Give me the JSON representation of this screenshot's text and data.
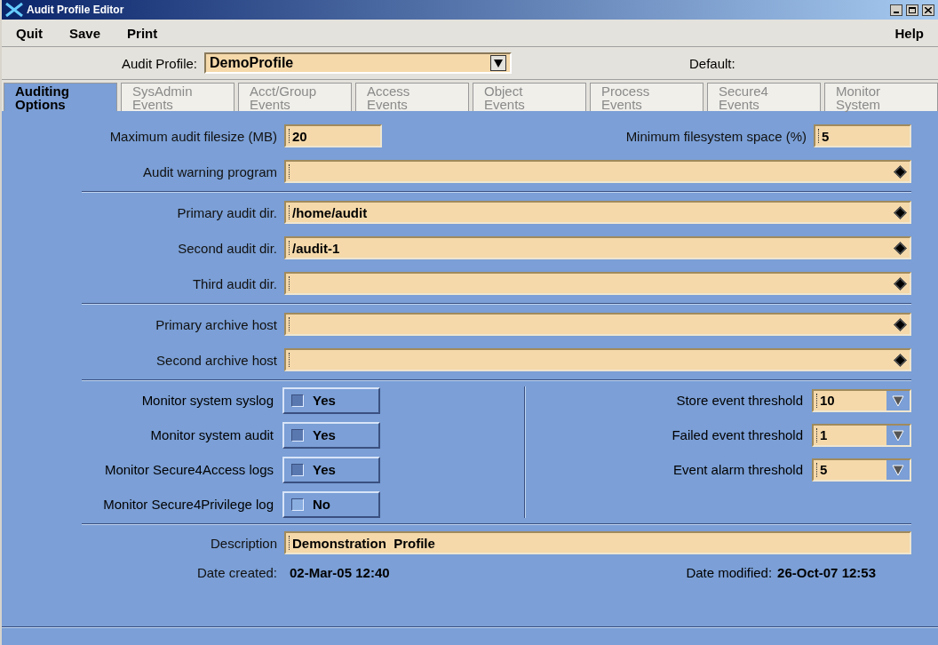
{
  "window": {
    "title": "Audit Profile Editor"
  },
  "menu": [
    {
      "label": "Quit"
    },
    {
      "label": "Save"
    },
    {
      "label": "Print"
    }
  ],
  "help_menu": {
    "label": "Help"
  },
  "profile": {
    "label": "Audit Profile:",
    "value": "DemoProfile",
    "default_label": "Default:"
  },
  "tabs": [
    {
      "label": "Auditing\nOptions",
      "selected": true
    },
    {
      "label": "SysAdmin\nEvents",
      "selected": false
    },
    {
      "label": "Acct/Group\nEvents",
      "selected": false
    },
    {
      "label": "Access\nEvents",
      "selected": false
    },
    {
      "label": "Object\nEvents",
      "selected": false
    },
    {
      "label": "Process\nEvents",
      "selected": false
    },
    {
      "label": "Secure4\nEvents",
      "selected": false
    },
    {
      "label": "Monitor\nSystem",
      "selected": false
    }
  ],
  "size_row": [
    {
      "label": "Maximum audit filesize (MB)",
      "value": "20"
    },
    {
      "label": "Minimum filesystem space (%)",
      "value": "5"
    }
  ],
  "field_groups": [
    [
      {
        "label": "Audit warning program"
      }
    ],
    [
      {
        "label": "Primary audit dir.",
        "value": "/home/audit"
      },
      {
        "label": "Second audit dir.",
        "value": "/audit-1"
      },
      {
        "label": "Third audit dir."
      }
    ],
    [
      {
        "label": "Primary archive host"
      },
      {
        "label": "Second archive host"
      }
    ]
  ],
  "toggles": [
    {
      "label": "Monitor system syslog",
      "text": "Yes",
      "checked": true
    },
    {
      "label": "Monitor system audit",
      "text": "Yes",
      "checked": true
    },
    {
      "label": "Monitor Secure4Access logs",
      "text": "Yes",
      "checked": true
    },
    {
      "label": "Monitor Secure4Privilege log",
      "text": "No",
      "checked": false
    }
  ],
  "thresholds": [
    {
      "label": "Store event threshold",
      "value": "10"
    },
    {
      "label": "Failed event threshold",
      "value": "1"
    },
    {
      "label": "Event alarm threshold",
      "value": "5"
    }
  ],
  "description": {
    "label": "Description",
    "value": "Demonstration  Profile"
  },
  "dates": [
    {
      "label": "Date created:",
      "value": "02-Mar-05 12:40"
    },
    {
      "label": "Date modified:",
      "value": "26-Oct-07 12:53"
    }
  ]
}
